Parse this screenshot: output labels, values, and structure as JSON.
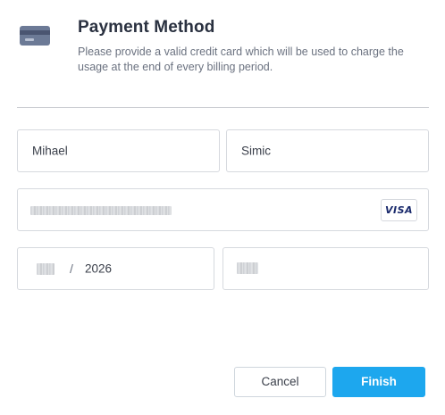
{
  "header": {
    "icon": "credit-card-icon",
    "title": "Payment Method",
    "subtitle": "Please provide a valid credit card which will be used to charge the usage at the end of every billing period."
  },
  "form": {
    "first_name": "Mihael",
    "last_name": "Simic",
    "card_brand": "VISA",
    "expiry_separator": "/",
    "expiry_year": "2026"
  },
  "buttons": {
    "cancel_label": "Cancel",
    "finish_label": "Finish"
  },
  "colors": {
    "primary": "#1da7ee",
    "border": "#d6d9de",
    "title": "#2a3140",
    "muted": "#6b7280"
  }
}
